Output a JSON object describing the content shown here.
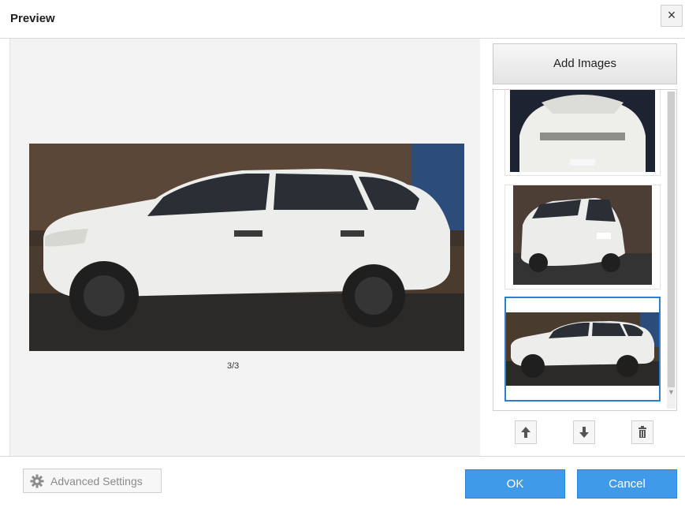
{
  "dialog": {
    "title": "Preview",
    "close_glyph": "×"
  },
  "preview": {
    "counter": "3/3"
  },
  "sidebar": {
    "add_images_label": "Add Images",
    "selected_index": 3
  },
  "footer": {
    "advanced_settings_label": "Advanced Settings",
    "ok_label": "OK",
    "cancel_label": "Cancel"
  },
  "icons": {
    "close": "close-icon",
    "up": "arrow-up-icon",
    "down": "arrow-down-icon",
    "delete": "trash-icon",
    "gear": "gear-icon"
  },
  "colors": {
    "accent": "#3f9bea",
    "selection_border": "#2d7fd6"
  }
}
